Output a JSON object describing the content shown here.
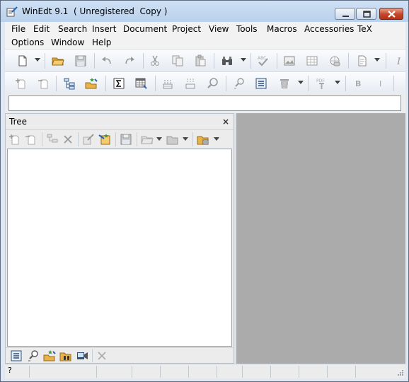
{
  "window": {
    "title": "WinEdt 9.1  ( Unregistered  Copy )"
  },
  "menubar": {
    "items": [
      {
        "label": "File"
      },
      {
        "label": "Edit"
      },
      {
        "label": "Search"
      },
      {
        "label": "Insert"
      },
      {
        "label": "Document"
      },
      {
        "label": "Project"
      },
      {
        "label": "View"
      },
      {
        "label": "Tools"
      },
      {
        "label": "Macros"
      },
      {
        "label": "Accessories"
      },
      {
        "label": "TeX"
      },
      {
        "label": "Options"
      },
      {
        "label": "Window"
      },
      {
        "label": "Help"
      }
    ]
  },
  "toolbar": {
    "bold_label": "B",
    "italic_label": "I",
    "pdf_label": "PDF",
    "spell_label": "ABC"
  },
  "command_input": {
    "value": "",
    "placeholder": ""
  },
  "tree_panel": {
    "title": "Tree",
    "close_label": "×"
  },
  "statusbar": {
    "help_label": "?"
  },
  "colors": {
    "editor_background": "#ababab",
    "title_gradient": "#b9d1ec",
    "close_button": "#c6442b"
  }
}
